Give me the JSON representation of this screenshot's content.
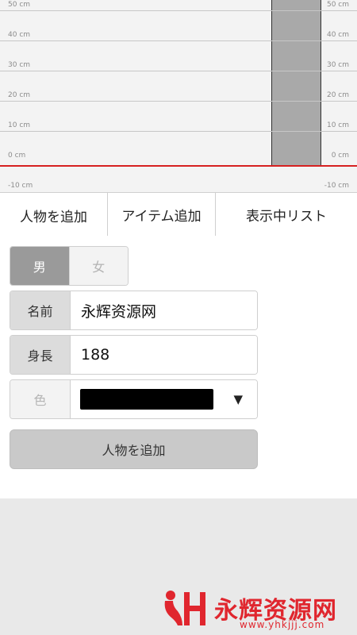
{
  "ruler": {
    "ticks": [
      "50 cm",
      "40 cm",
      "30 cm",
      "20 cm",
      "10 cm",
      "0 cm",
      "-10 cm"
    ],
    "tick_values_cm": [
      50,
      40,
      30,
      20,
      10,
      0,
      -10
    ],
    "zero_line_color": "#d62020",
    "person_bar_color": "#a9a9a9"
  },
  "tabs": [
    {
      "label": "人物を追加",
      "active": true
    },
    {
      "label": "アイテム追加",
      "active": false
    },
    {
      "label": "表示中リスト",
      "active": false
    }
  ],
  "form": {
    "gender": {
      "male_label": "男",
      "female_label": "女",
      "selected": "男"
    },
    "name_label": "名前",
    "name_value": "永辉资源网",
    "height_label": "身長",
    "height_value": "188",
    "color_label": "色",
    "color_value": "#000000",
    "color_dropdown_icon": "triangle-down-icon",
    "add_button_label": "人物を追加"
  },
  "watermark": {
    "text": "永辉资源网",
    "url": "www.yhkjjj.com",
    "logo_text": "YH",
    "color": "#e0262e"
  }
}
